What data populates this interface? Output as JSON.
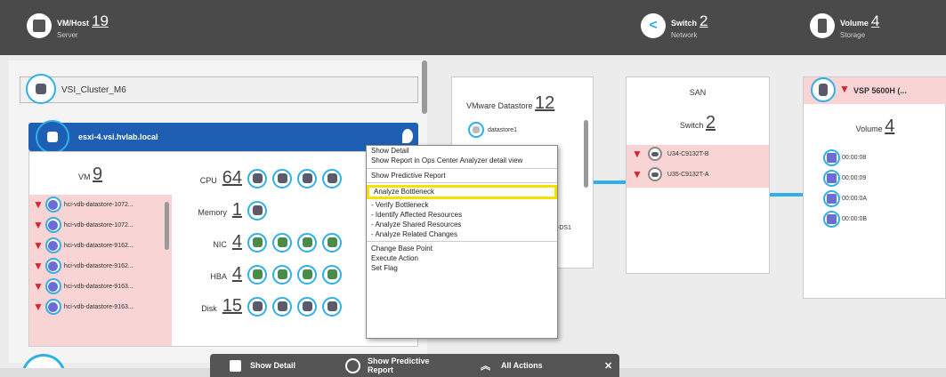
{
  "header": {
    "server": {
      "title": "VM/Host",
      "count": "19",
      "subtitle": "Server"
    },
    "network": {
      "title": "Switch",
      "count": "2",
      "subtitle": "Network"
    },
    "storage": {
      "title": "Volume",
      "count": "4",
      "subtitle": "Storage"
    }
  },
  "cluster": {
    "name": "VSI_Cluster_M6"
  },
  "host": {
    "name": "esxi-4.vsi.hvlab.local"
  },
  "vm": {
    "label": "VM",
    "count": "9",
    "items": [
      "hci-vdb-datastore-1072...",
      "hci-vdb-datastore-1072...",
      "hci-vdb-datastore-9162...",
      "hci-vdb-datastore-9162...",
      "hci-vdb-datastore-9163...",
      "hci-vdb-datastore-9163..."
    ]
  },
  "resources": [
    {
      "label": "CPU",
      "count": "64"
    },
    {
      "label": "Memory",
      "count": "1"
    },
    {
      "label": "NIC",
      "count": "4"
    },
    {
      "label": "HBA",
      "count": "4"
    },
    {
      "label": "Disk",
      "count": "15"
    }
  ],
  "datastore": {
    "label": "VMware Datastore",
    "count": "12",
    "item": "datastore1",
    "partial": "-DS1"
  },
  "san": {
    "title": "SAN",
    "label": "Switch",
    "count": "2",
    "items": [
      "U34-C9132T-B",
      "U35-C9132T-A"
    ]
  },
  "storage_panel": {
    "name": "VSP 5600H (...",
    "label": "Volume",
    "count": "4",
    "volumes": [
      "00:00:08",
      "00:00:09",
      "00:00:0A",
      "00:00:0B"
    ]
  },
  "menu": [
    {
      "label": "Show Detail"
    },
    {
      "label": "Show Report in Ops Center Analyzer detail view",
      "sep": true
    },
    {
      "label": "Show Predictive Report",
      "sep": true
    },
    {
      "label": "Analyze Bottleneck",
      "highlight": true
    },
    {
      "label": "- Verify Bottleneck"
    },
    {
      "label": "- Identify Affected Resources"
    },
    {
      "label": "- Analyze Shared Resources"
    },
    {
      "label": "- Analyze Related Changes",
      "sep": true
    },
    {
      "label": "Change Base Point"
    },
    {
      "label": "Execute Action"
    },
    {
      "label": "Set Flag"
    }
  ],
  "toolbar": {
    "show_detail": "Show Detail",
    "predictive_line1": "Show Predictive",
    "predictive_line2": "Report",
    "all_actions": "All Actions",
    "close": "✕"
  },
  "colors": {
    "accent": "#2fb0e6",
    "alert": "#d9232d",
    "highlight": "#f5e100",
    "host_bar": "#1f5fb3"
  }
}
